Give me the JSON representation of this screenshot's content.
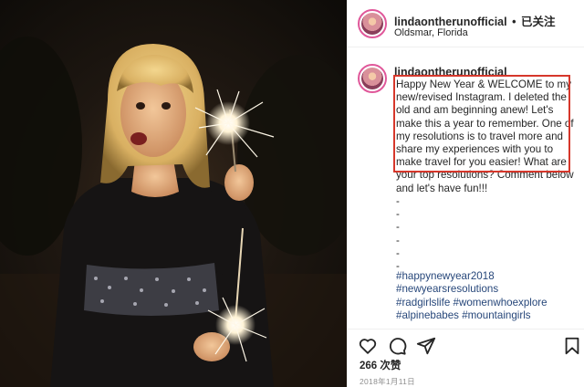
{
  "post": {
    "username": "lindaontherunofficial",
    "follow_label": "已关注",
    "separator": "•",
    "location": "Oldsmar, Florida"
  },
  "caption": {
    "username": "lindaontherunofficial",
    "text": "Happy New Year & WELCOME to my new/revised Instagram. I deleted the old and am beginning anew! Let's make this a year to remember. One of my resolutions is to travel more and share my experiences with you to make travel for you easier! What are your top resolutions? Comment below and let's have fun!!!",
    "dashes": [
      "-",
      "-",
      "-",
      "-",
      "-",
      "-"
    ],
    "hashtags": [
      "#happynewyear2018",
      "#newyearsresolutions",
      "#radgirlslife #womenwhoexplore",
      "#alpinebabes #mountaingirls"
    ]
  },
  "actions": {
    "icons": [
      "heart-icon",
      "comment-icon",
      "share-icon",
      "bookmark-icon"
    ]
  },
  "likes": "266 次赞",
  "date": "2018年1月11日",
  "colors": {
    "highlight_box": "#d6372b",
    "hashtag": "#27477a",
    "avatar_ring": "#e0589a"
  }
}
